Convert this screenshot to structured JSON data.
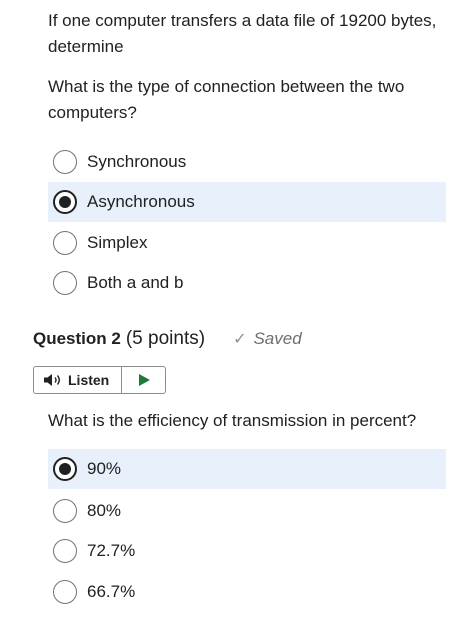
{
  "question1": {
    "text": "If one computer transfers a data file of 19200 bytes, determine",
    "prompt": "What is the type of connection between the two computers?",
    "options": [
      {
        "label": "Synchronous",
        "selected": false
      },
      {
        "label": "Asynchronous",
        "selected": true
      },
      {
        "label": "Simplex",
        "selected": false
      },
      {
        "label": "Both a and b",
        "selected": false
      }
    ]
  },
  "question2": {
    "title": "Question 2",
    "points": "(5 points)",
    "status": "Saved",
    "listen_label": "Listen",
    "prompt": "What is the efficiency of transmission in percent?",
    "options": [
      {
        "label": "90%",
        "selected": true
      },
      {
        "label": "80%",
        "selected": false
      },
      {
        "label": "72.7%",
        "selected": false
      },
      {
        "label": "66.7%",
        "selected": false
      }
    ]
  },
  "icons": {
    "saved": "checkmark-icon",
    "listen": "speaker-icon",
    "play": "play-icon"
  },
  "colors": {
    "selected_row": "#e8f1fb",
    "text": "#202122",
    "status": "#6b6f73"
  }
}
